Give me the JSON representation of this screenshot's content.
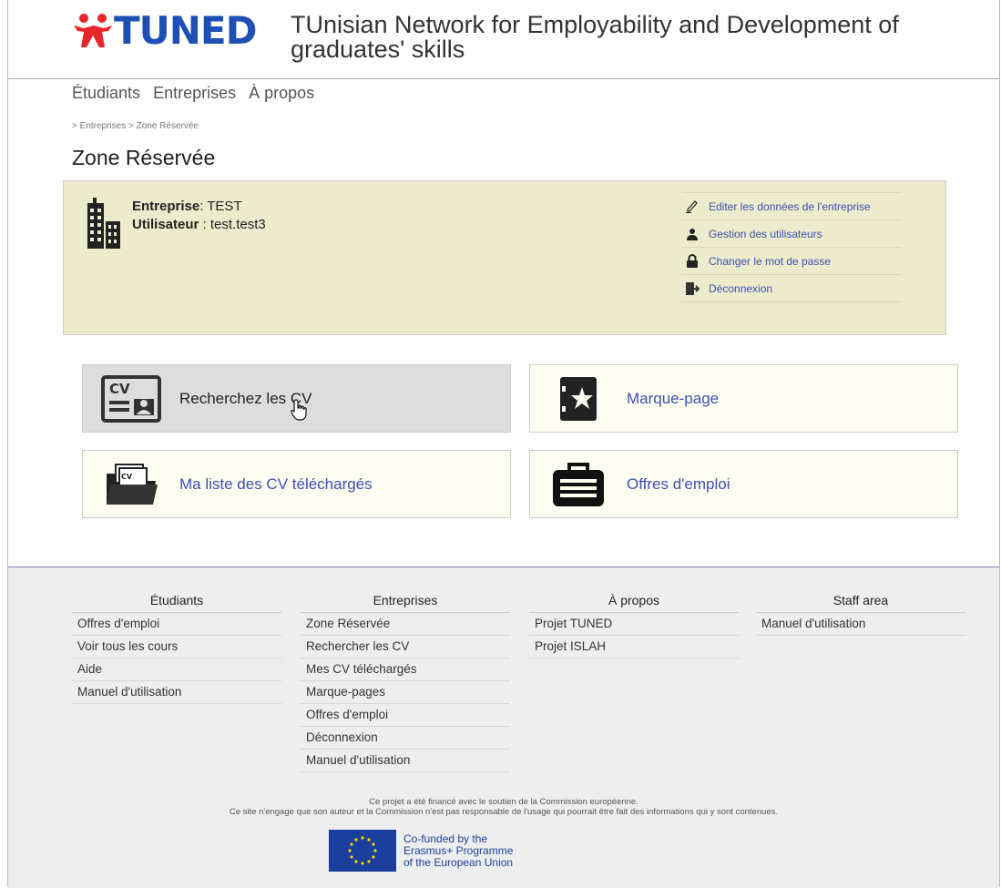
{
  "header": {
    "logo_text": "TUNED",
    "tagline": "TUnisian Network for Employability and Development of graduates' skills"
  },
  "nav": {
    "items": [
      "Étudiants",
      "Entreprises",
      "À propos"
    ]
  },
  "breadcrumb": {
    "items": [
      "Entreprises",
      "Zone Réservée"
    ]
  },
  "page_title": "Zone Réservée",
  "info": {
    "company_label": "Entreprise",
    "company_value": ": TEST",
    "user_label": "Utilisateur",
    "user_value": " : test.test3",
    "actions": [
      {
        "label": "Editer les données de l'entreprise",
        "icon": "pencil-icon"
      },
      {
        "label": "Gestion des utilisateurs",
        "icon": "users-icon"
      },
      {
        "label": "Changer le mot de passe",
        "icon": "lock-icon"
      },
      {
        "label": "Déconnexion",
        "icon": "logout-icon"
      }
    ]
  },
  "tiles": [
    {
      "label": "Recherchez les CV",
      "icon": "cv-icon"
    },
    {
      "label": "Marque-page",
      "icon": "bookmark-icon"
    },
    {
      "label": "Ma liste des CV téléchargés",
      "icon": "folder-cv-icon"
    },
    {
      "label": "Offres d'emploi",
      "icon": "briefcase-icon"
    }
  ],
  "footer": {
    "columns": [
      {
        "title": "Étudiants",
        "items": [
          "Offres d'emploi",
          "Voir tous les cours",
          "Aide",
          "Manuel d'utilisation"
        ]
      },
      {
        "title": "Entreprises",
        "items": [
          "Zone Réservée",
          "Rechercher les CV",
          "Mes CV téléchargés",
          "Marque-pages",
          "Offres d'emploi",
          "Déconnexion",
          "Manuel d'utilisation"
        ]
      },
      {
        "title": "À propos",
        "items": [
          "Projet TUNED",
          "Projet ISLAH"
        ]
      },
      {
        "title": "Staff area",
        "items": [
          "Manuel d'utilisation"
        ]
      }
    ],
    "note_line1": "Ce projet a été financé avec le soutien de la Commission européenne.",
    "note_line2": "Ce site n'engage que son auteur et la Commission n'est pas responsable de l'usage qui pourrait être fait des informations qui y sont contenues.",
    "eu_text": [
      "Co-funded by the",
      "Erasmus+ Programme",
      "of the European Union"
    ]
  },
  "colors": {
    "brand_blue": "#1e4fb4",
    "brand_red": "#e8252a",
    "link": "#3c50b4",
    "info_bg": "#ecebcb",
    "tile_bg": "#fefdf2"
  }
}
